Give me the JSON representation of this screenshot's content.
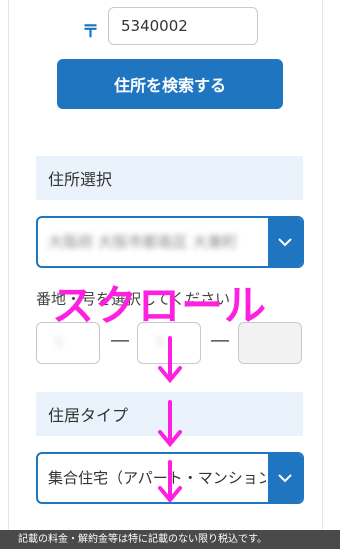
{
  "postal": {
    "mark": "〒",
    "value": "5340002"
  },
  "search_button": "住所を検索する",
  "address_section": {
    "heading": "住所選択",
    "selected_value": "大阪府 大阪市都島区 大東町"
  },
  "banchi": {
    "label": "番地・号を選択してください",
    "field1_value": "5",
    "field2_value": "5",
    "dash": "―"
  },
  "residence_section": {
    "heading": "住居タイプ",
    "selected_value": "集合住宅（アパート・マンション）"
  },
  "overlay": {
    "text": "スクロール",
    "color": "#ff1fe0"
  },
  "notice": "記載の料金・解約金等は特に記載のない限り税込です。",
  "colors": {
    "accent": "#1f75c0",
    "section_bg": "#eaf3fb"
  }
}
